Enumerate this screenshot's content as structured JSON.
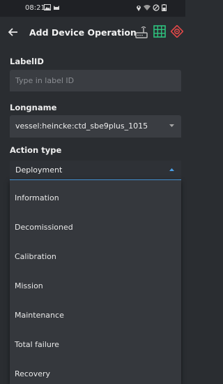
{
  "status": {
    "time": "08:21"
  },
  "header": {
    "title": "Add Device Operation"
  },
  "colors": {
    "accent": "#4ba0e8",
    "danger": "#e04848",
    "success": "#2ec27e",
    "neutral": "#b8b8b8"
  },
  "icons": [
    "back-arrow-icon",
    "router-icon",
    "grid-icon",
    "target-icon"
  ],
  "form": {
    "label_id": {
      "label": "LabelID",
      "placeholder": "Type in label ID"
    },
    "longname": {
      "label": "Longname",
      "value": "vessel:heincke:ctd_sbe9plus_1015"
    },
    "action_type": {
      "label": "Action type",
      "value": "Deployment"
    }
  },
  "menu": {
    "items": [
      {
        "label": "Information"
      },
      {
        "label": "Decomissioned"
      },
      {
        "label": "Calibration"
      },
      {
        "label": "Mission"
      },
      {
        "label": "Maintenance"
      },
      {
        "label": "Total failure"
      },
      {
        "label": "Recovery"
      }
    ]
  }
}
